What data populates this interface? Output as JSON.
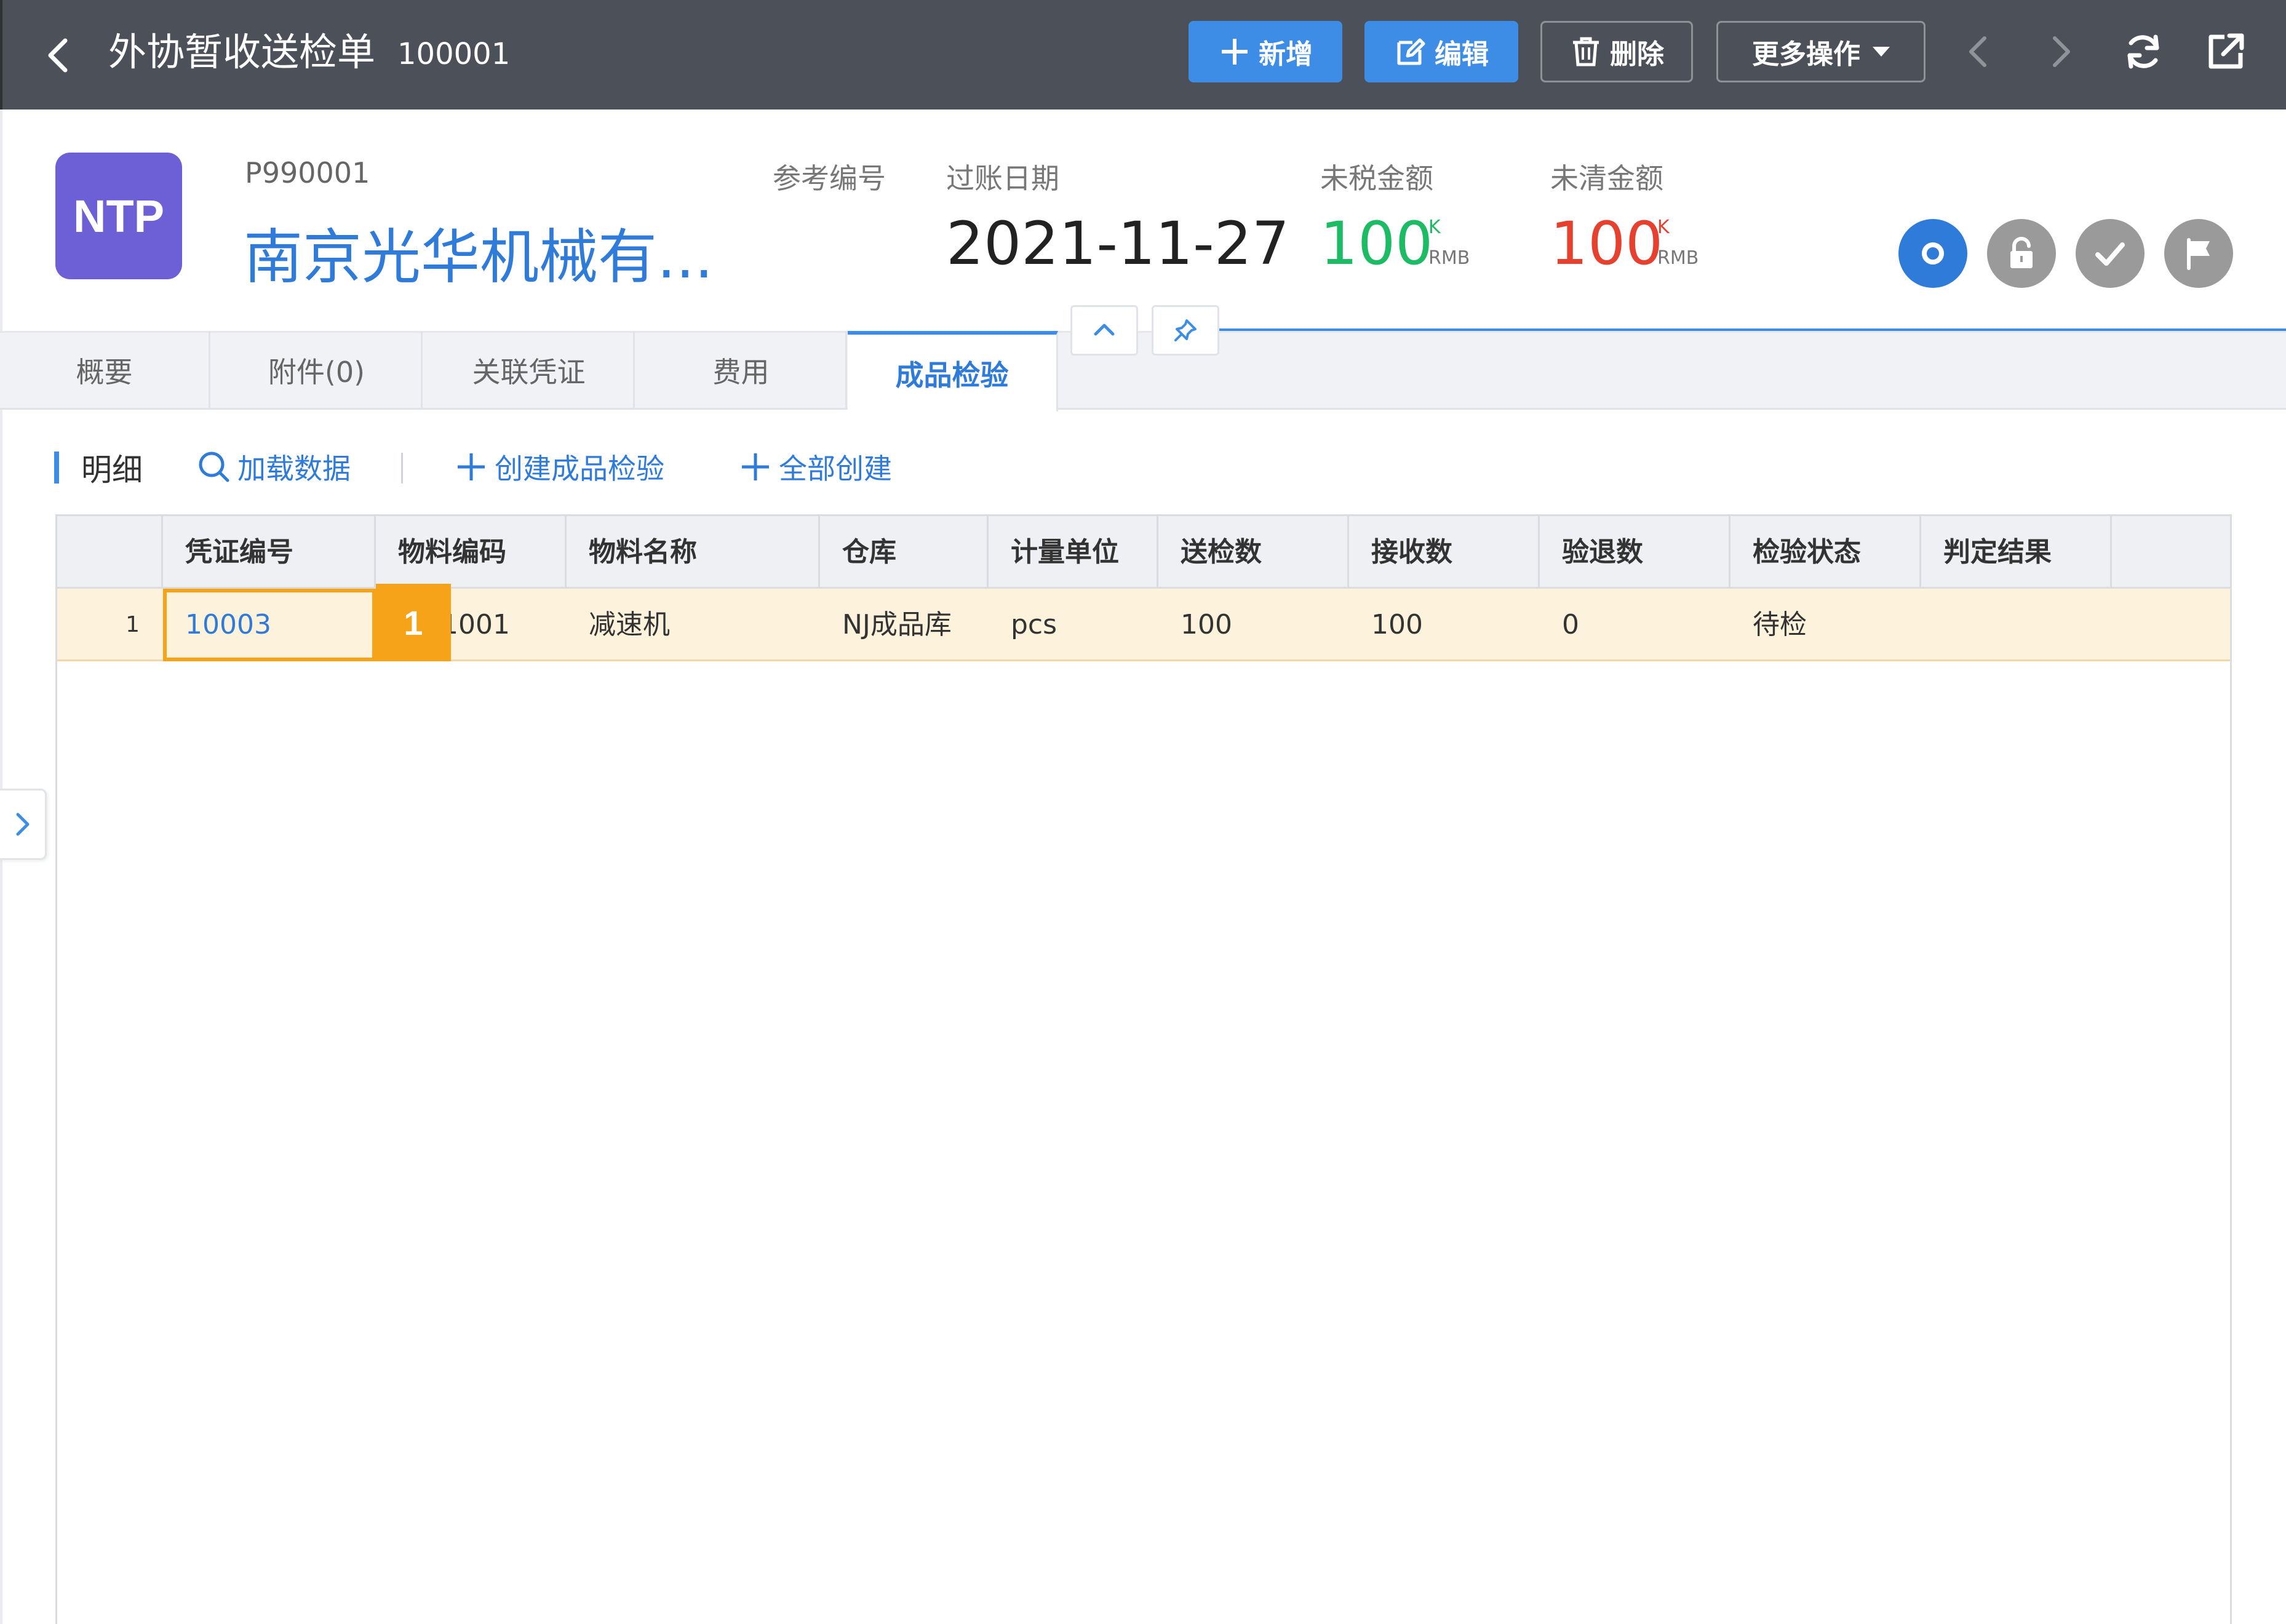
{
  "header": {
    "title": "外协暂收送检单",
    "doc_no": "100001",
    "buttons": {
      "new": "新增",
      "edit": "编辑",
      "delete": "删除",
      "more": "更多操作"
    }
  },
  "partner": {
    "logo_text": "NTP",
    "code": "P990001",
    "name": "南京光华机械有..."
  },
  "meta": {
    "ref_no_label": "参考编号",
    "post_date_label": "过账日期",
    "post_date": "2021-11-27",
    "untaxed_label": "未税金额",
    "untaxed_amount": "100",
    "untaxed_unit": "K",
    "untaxed_currency": "RMB",
    "open_label": "未清金额",
    "open_amount": "100",
    "open_unit": "K",
    "open_currency": "RMB"
  },
  "tabs": [
    {
      "label": "概要"
    },
    {
      "label": "附件(0)"
    },
    {
      "label": "关联凭证"
    },
    {
      "label": "费用"
    },
    {
      "label": "成品检验"
    }
  ],
  "active_tab": "成品检验",
  "section": {
    "title": "明细",
    "actions": {
      "load": "加载数据",
      "create": "创建成品检验",
      "create_all": "全部创建"
    }
  },
  "table": {
    "columns": [
      "凭证编号",
      "物料编码",
      "物料名称",
      "仓库",
      "计量单位",
      "送检数",
      "接收数",
      "验退数",
      "检验状态",
      "判定结果"
    ],
    "rows": [
      {
        "row_no": "1",
        "voucher_no": "10003",
        "material_code": "1001",
        "material_name": "减速机",
        "warehouse": "NJ成品库",
        "uom": "pcs",
        "sent_qty": "100",
        "received_qty": "100",
        "returned_qty": "0",
        "inspection_status": "待检",
        "result": ""
      }
    ],
    "selected_badge": "1"
  },
  "colors": {
    "topbar": "#4c5159",
    "primary": "#3d8de6",
    "logo": "#6d5fd6",
    "green": "#1dbb64",
    "red": "#e5412e",
    "selection": "#f7a319",
    "row_highlight": "#fdf2dc"
  },
  "icons": [
    "back-arrow-icon",
    "plus-icon",
    "edit-icon",
    "trash-icon",
    "caret-down-icon",
    "chevron-left-icon",
    "chevron-right-icon",
    "refresh-icon",
    "export-icon",
    "circle-status-icon",
    "lock-icon",
    "check-icon",
    "flag-icon",
    "chevron-up-icon",
    "pin-icon",
    "search-icon",
    "chevron-right-small-icon"
  ]
}
